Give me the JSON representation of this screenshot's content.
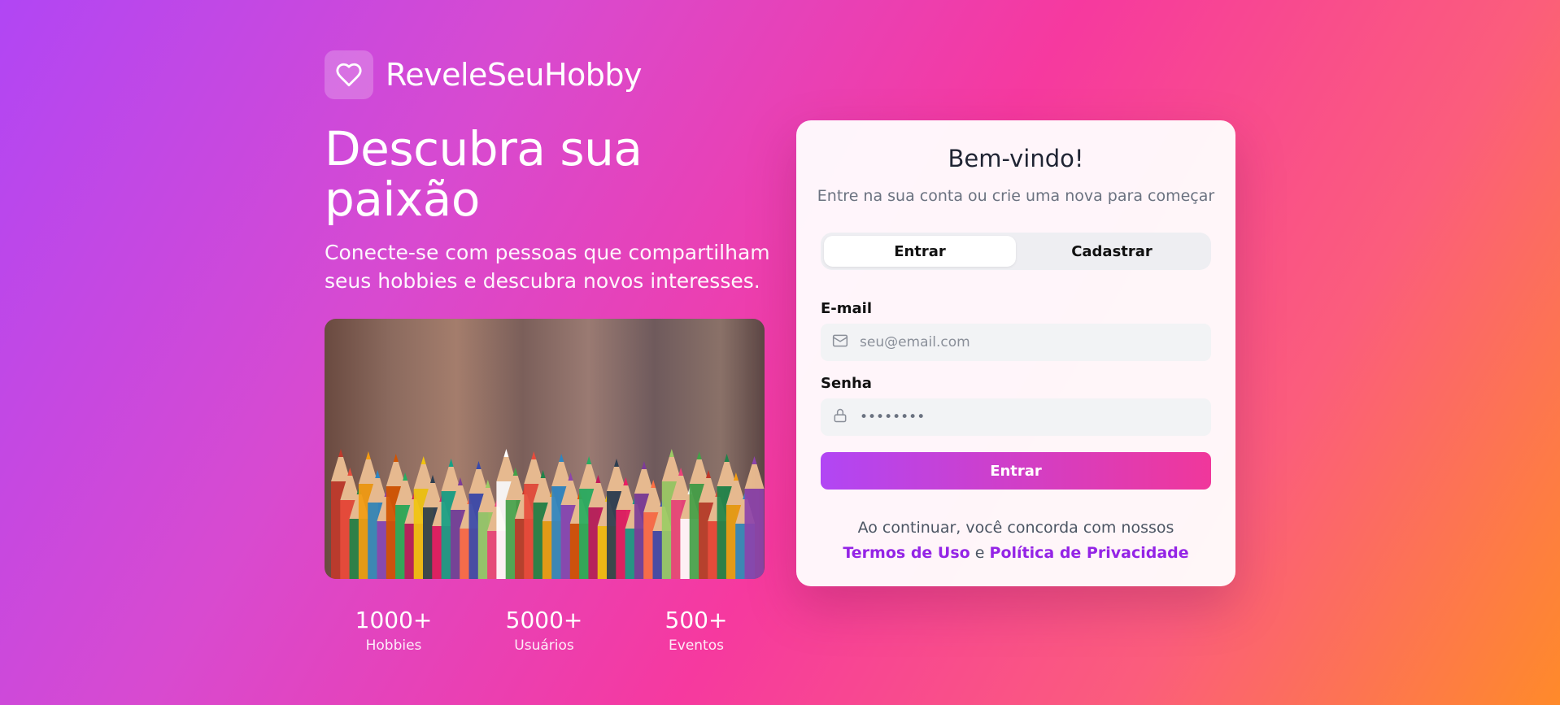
{
  "brand": {
    "name": "ReveleSeuHobby",
    "icon": "heart-icon"
  },
  "hero": {
    "title": "Descubra sua paixão",
    "subtitle": "Conecte-se com pessoas que compartilham seus hobbies e descubra novos interesses.",
    "image_subject": "colored pencils"
  },
  "stats": [
    {
      "value": "1000+",
      "label": "Hobbies"
    },
    {
      "value": "5000+",
      "label": "Usuários"
    },
    {
      "value": "500+",
      "label": "Eventos"
    }
  ],
  "auth": {
    "title": "Bem-vindo!",
    "subtitle": "Entre na sua conta ou crie uma nova para começar",
    "tabs": [
      {
        "label": "Entrar",
        "active": true
      },
      {
        "label": "Cadastrar",
        "active": false
      }
    ],
    "email": {
      "label": "E-mail",
      "placeholder": "seu@email.com",
      "icon": "mail-icon"
    },
    "password": {
      "label": "Senha",
      "value": "••••••••",
      "icon": "lock-icon"
    },
    "submit_label": "Entrar",
    "terms": {
      "prefix": "Ao continuar, você concorda com nossos",
      "terms_link": "Termos de Uso",
      "conjunction": "e",
      "privacy_link": "Política de Privacidade"
    }
  },
  "colors": {
    "gradient_start": "#b146f4",
    "gradient_mid": "#f6399f",
    "gradient_end": "#ff8a2a",
    "link": "#9424e6"
  }
}
